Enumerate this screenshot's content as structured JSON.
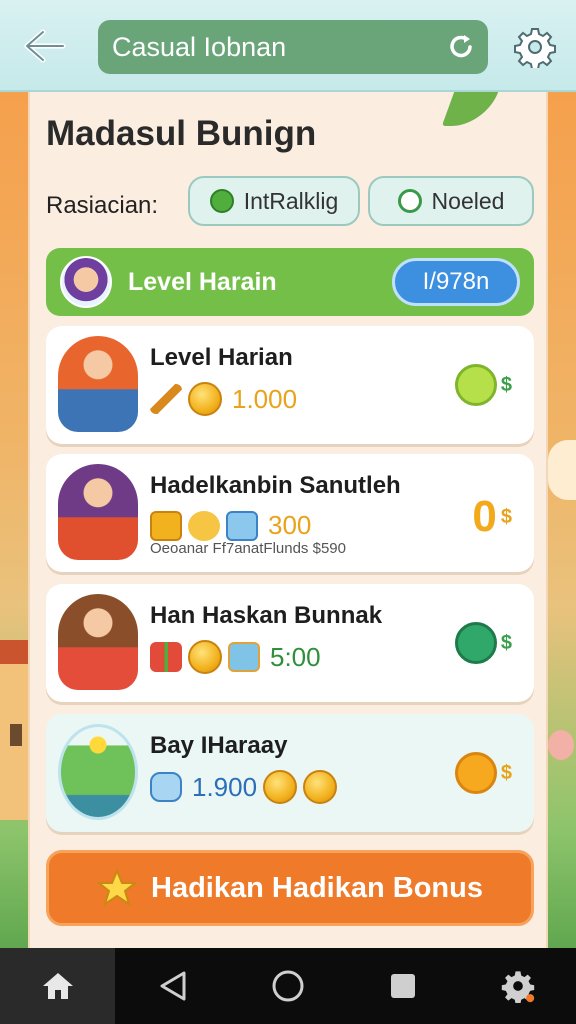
{
  "topbar": {
    "url_text": "Casual Iobnan"
  },
  "page": {
    "title": "Madasul Bunign",
    "filter_label": "Rasiacian:",
    "chips": [
      {
        "label": "IntRalklig",
        "icon": "leaf-icon"
      },
      {
        "label": "Noeled",
        "icon": "search-icon"
      }
    ]
  },
  "level_banner": {
    "label": "Level Harain",
    "pill": "I/978n"
  },
  "cards": [
    {
      "name": "Level Harian",
      "amount": "1.000",
      "sub": ""
    },
    {
      "name": "Hadelkanbin Sanutleh",
      "amount": "300",
      "sub": "Oeoanar  Ff7anatFlunds $590",
      "status": "0"
    },
    {
      "name": "Han Haskan Bunnak",
      "amount": "5:00",
      "sub": ""
    },
    {
      "name": "Bay IHaraay",
      "amount": "1.900",
      "sub": ""
    }
  ],
  "bonus_button": {
    "label": "Hadikan Hadikan Bonus"
  },
  "status_symbol": "$",
  "colors": {
    "accent_green": "#74bf48",
    "accent_orange": "#ef7a2a",
    "pill_blue": "#3d8fe0",
    "coin_gold": "#f2b21e"
  },
  "nav": [
    "home-icon",
    "back-triangle-icon",
    "home-circle-icon",
    "recents-square-icon",
    "settings-icon"
  ]
}
